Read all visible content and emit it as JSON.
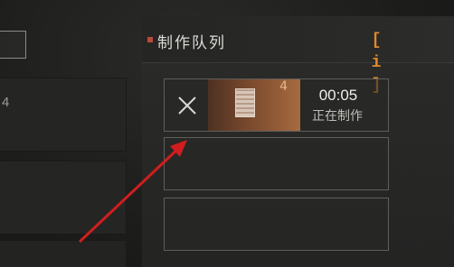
{
  "left_panel": {
    "tiles": [
      {
        "count": "4"
      }
    ]
  },
  "queue": {
    "title": "制作队列",
    "info_label": "[ i ]",
    "active_item": {
      "quantity": "4",
      "timer": "00:05",
      "status": "正在制作"
    }
  },
  "colors": {
    "accent": "#e08a2c",
    "item_bg": "#7a4a2e",
    "arrow": "#d01e1e"
  }
}
